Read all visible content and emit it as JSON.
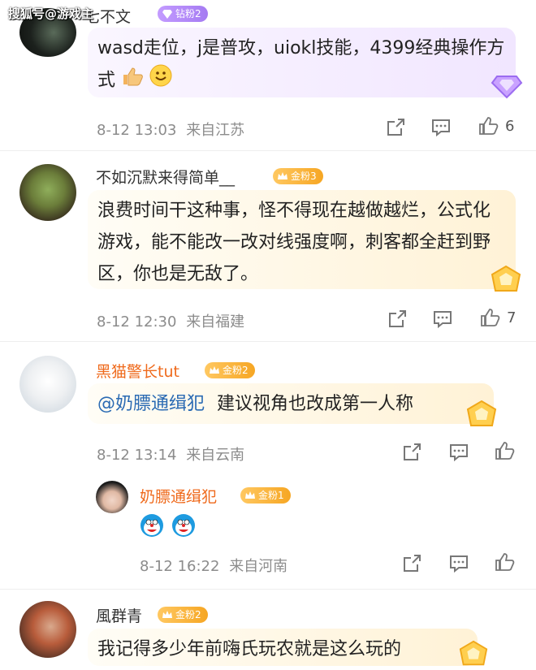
{
  "watermark": "搜狐号@游戏主",
  "comments": [
    {
      "username": "七不文",
      "badge": "钻粉2",
      "text": "wasd走位，j是普攻，uiokl技能，4399经典操作方式",
      "time": "8-12 13:03",
      "location": "来自江苏",
      "likes": "6"
    },
    {
      "username": "不如沉默来得简单__",
      "badge": "金粉3",
      "text": "浪费时间干这种事，怪不得现在越做越烂，公式化游戏，能不能改一改对线强度啊，刺客都全赶到野区，你也是无敌了。",
      "time": "8-12 12:30",
      "location": "来自福建",
      "likes": "7"
    },
    {
      "username": "黑猫警长tut",
      "badge": "金粉2",
      "mention": "@奶膘通缉犯",
      "text": "建议视角也改成第一人称",
      "time": "8-12 13:14",
      "location": "来自云南",
      "likes": ""
    },
    {
      "username": "奶膘通缉犯",
      "badge": "金粉1",
      "text": "",
      "time": "8-12 16:22",
      "location": "来自河南",
      "likes": ""
    },
    {
      "username": "風群青",
      "badge": "金粉2",
      "text": "我记得多少年前嗨氏玩农就是这么玩的",
      "time": "",
      "location": "",
      "likes": ""
    }
  ],
  "colors": {
    "vip_name": "#ef6a1c",
    "mention": "#2a6ab3",
    "meta": "#8c8c8c",
    "diamond_badge": "#b18cf9",
    "gold_badge": "#f6b335"
  },
  "icons": [
    "share-icon",
    "comment-icon",
    "like-icon",
    "thumbs-up-emoji",
    "smile-emoji",
    "doraemon-emoji",
    "diamond-deco-icon",
    "gold-deco-icon",
    "crown-icon"
  ]
}
